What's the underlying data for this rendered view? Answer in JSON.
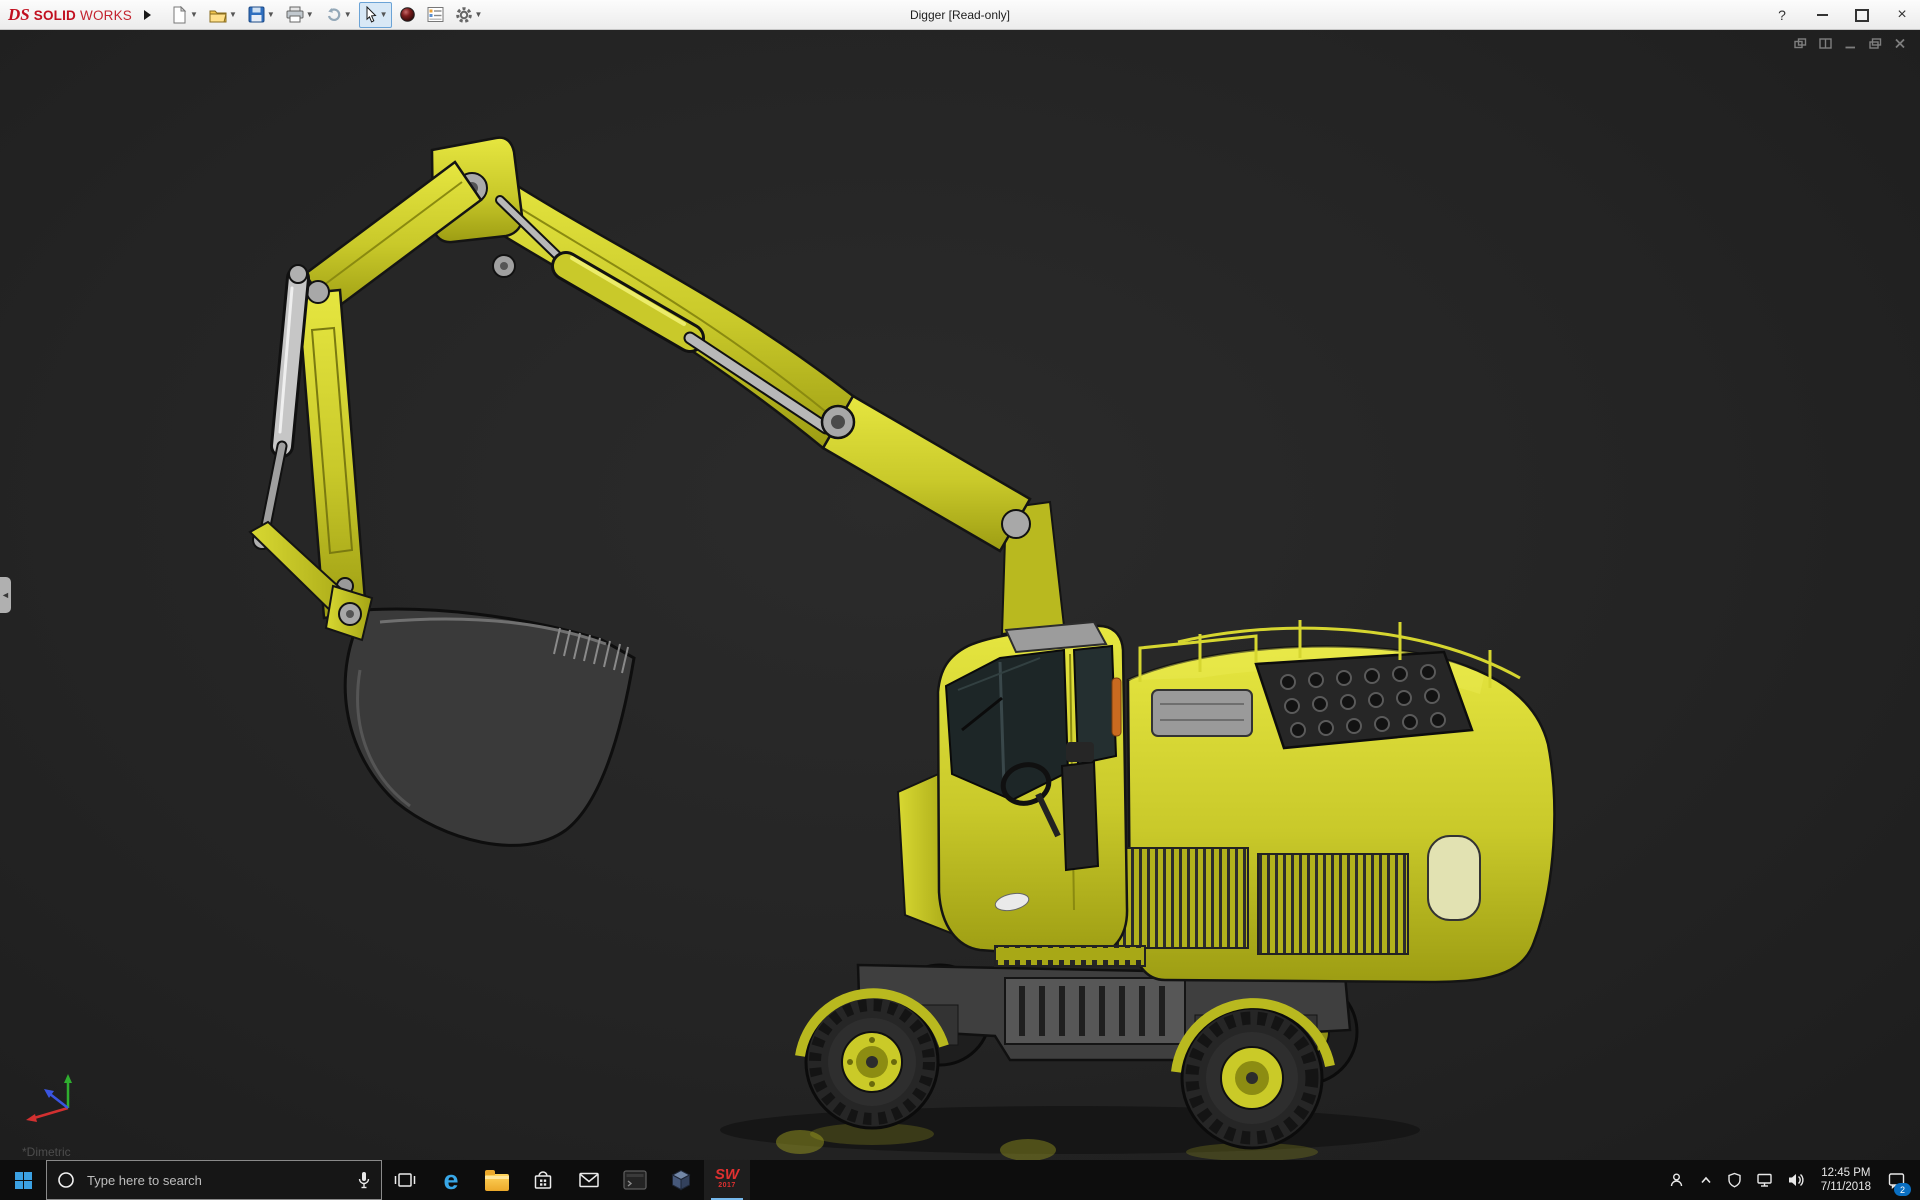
{
  "window": {
    "brand": {
      "logo_text": "DS",
      "name_bold": "SOLID",
      "name_light": "WORKS"
    },
    "title": "Digger [Read-only]",
    "controls": {
      "help": "?",
      "close": "×"
    }
  },
  "toolbar": {
    "tools": [
      {
        "name": "new-document"
      },
      {
        "name": "open"
      },
      {
        "name": "save"
      },
      {
        "name": "print"
      },
      {
        "name": "undo"
      },
      {
        "name": "select-cursor",
        "active": true
      },
      {
        "name": "appearance-sphere"
      },
      {
        "name": "properties"
      },
      {
        "name": "options-gear"
      }
    ]
  },
  "viewport": {
    "document_name": "Digger",
    "view_label": "*Dimetric",
    "background_color": "#242424",
    "model_colors": {
      "body": "#c9c92a",
      "bucket": "#3a3a3a",
      "hydraulics": "#b8b8b8"
    }
  },
  "taskbar": {
    "search": {
      "placeholder": "Type here to search"
    },
    "apps": [
      "start",
      "task-view",
      "edge",
      "file-explorer",
      "store",
      "mail",
      "console",
      "cad-cube",
      "solidworks-2017"
    ],
    "solidworks_badge": {
      "top": "SW",
      "bottom": "2017"
    },
    "tray": {
      "time": "12:45 PM",
      "date": "7/11/2018",
      "notification_count": "2"
    }
  }
}
